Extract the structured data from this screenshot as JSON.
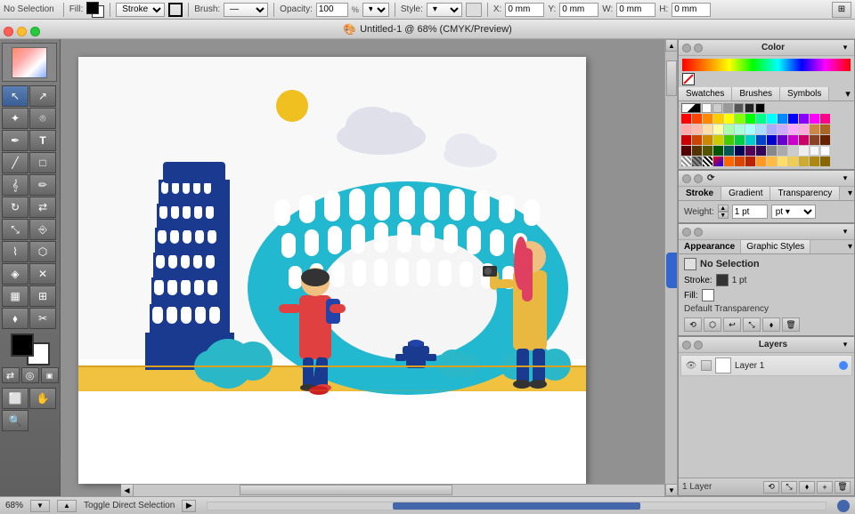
{
  "app": {
    "title": "Untitled-1 @ 68% (CMYK/Preview)",
    "title_icon": "🎨"
  },
  "toolbar": {
    "no_selection": "No Selection",
    "fill_label": "Fill:",
    "stroke_label": "Stroke",
    "brush_label": "Brush:",
    "opacity_label": "Opacity:",
    "opacity_value": "100",
    "style_label": "Style:",
    "x_label": "X:",
    "x_value": "0 mm",
    "y_label": "Y:",
    "y_value": "0 mm",
    "w_label": "W:",
    "w_value": "0 mm",
    "h_label": "H:",
    "h_value": "0 mm",
    "stroke_value": "1 pt"
  },
  "panels": {
    "color": {
      "title": "Color",
      "tabs": [
        "Swatches",
        "Brushes",
        "Symbols"
      ]
    },
    "stroke": {
      "title": "Stroke",
      "tabs": [
        "Stroke",
        "Gradient",
        "Transparency"
      ],
      "weight_label": "Weight:",
      "weight_value": "1 pt"
    },
    "appearance": {
      "title": "Appearance",
      "tabs": [
        "Appearance",
        "Graphic Styles"
      ],
      "no_selection": "No Selection",
      "stroke_label": "Stroke:",
      "stroke_value": "1 pt",
      "fill_label": "Fill:",
      "default_transparency": "Default Transparency"
    },
    "layers": {
      "title": "Layers",
      "layer_name": "Layer 1",
      "layer_count": "1 Layer"
    }
  },
  "status": {
    "zoom": "68%",
    "toggle_label": "Toggle Direct Selection",
    "arrow_label": "▶"
  },
  "tools": [
    {
      "name": "selection",
      "icon": "↖",
      "label": "Selection Tool"
    },
    {
      "name": "direct-selection",
      "icon": "↗",
      "label": "Direct Selection Tool"
    },
    {
      "name": "magic-wand",
      "icon": "✦",
      "label": "Magic Wand"
    },
    {
      "name": "lasso",
      "icon": "⬤",
      "label": "Lasso Tool"
    },
    {
      "name": "pen",
      "icon": "✒",
      "label": "Pen Tool"
    },
    {
      "name": "type",
      "icon": "T",
      "label": "Type Tool"
    },
    {
      "name": "line",
      "icon": "╱",
      "label": "Line Tool"
    },
    {
      "name": "rectangle",
      "icon": "□",
      "label": "Rectangle Tool"
    },
    {
      "name": "paintbrush",
      "icon": "🖌",
      "label": "Paintbrush"
    },
    {
      "name": "pencil",
      "icon": "✏",
      "label": "Pencil"
    },
    {
      "name": "rotate",
      "icon": "↻",
      "label": "Rotate"
    },
    {
      "name": "reflect",
      "icon": "⇄",
      "label": "Reflect"
    },
    {
      "name": "scale",
      "icon": "⤡",
      "label": "Scale"
    },
    {
      "name": "shear",
      "icon": "⎆",
      "label": "Shear"
    },
    {
      "name": "warp",
      "icon": "⌇",
      "label": "Warp"
    },
    {
      "name": "blend",
      "icon": "⬡",
      "label": "Blend"
    },
    {
      "name": "eyedropper",
      "icon": "💧",
      "label": "Eyedropper"
    },
    {
      "name": "measure",
      "icon": "✕",
      "label": "Measure"
    },
    {
      "name": "gradient",
      "icon": "▦",
      "label": "Gradient"
    },
    {
      "name": "mesh",
      "icon": "⊞",
      "label": "Mesh"
    },
    {
      "name": "live-paint",
      "icon": "⬧",
      "label": "Live Paint"
    },
    {
      "name": "scissors",
      "icon": "✂",
      "label": "Scissors"
    },
    {
      "name": "artboard",
      "icon": "⬜",
      "label": "Artboard"
    },
    {
      "name": "hand",
      "icon": "✋",
      "label": "Hand"
    },
    {
      "name": "zoom",
      "icon": "🔍",
      "label": "Zoom"
    }
  ],
  "swatches": {
    "row1": [
      "#ffffff",
      "#cccccc",
      "#999999",
      "#666666",
      "#333333",
      "#000000",
      "#ff0000",
      "#ff6600",
      "#ffff00",
      "#00ff00",
      "#00ffff",
      "#0000ff",
      "#ff00ff",
      "#8800ff"
    ],
    "row2": [
      "#ffcccc",
      "#ffcc99",
      "#ffffcc",
      "#ccffcc",
      "#ccffff",
      "#ccccff",
      "#ffccff",
      "#ddccff",
      "#ff8888",
      "#ffaa66",
      "#ffff88",
      "#88ff88",
      "#88ffff",
      "#8888ff"
    ],
    "row3": [
      "#cc0000",
      "#cc6600",
      "#cccc00",
      "#00cc00",
      "#00cccc",
      "#0000cc",
      "#cc00cc",
      "#6600cc",
      "#880000",
      "#884400",
      "#888800",
      "#008800",
      "#008888",
      "#000088"
    ],
    "row4": [
      "#440000",
      "#442200",
      "#444400",
      "#004400",
      "#004444",
      "#000044",
      "#440044",
      "#220044",
      "#ffdddd",
      "#ffeedd",
      "#ffffdd",
      "#ddffdd",
      "#ddffff",
      "#ddddff"
    ],
    "row5": [
      "#888888",
      "#777777",
      "#666666",
      "#555555",
      "#444444",
      "#333333",
      "#222222",
      "#111111",
      "#ff4444",
      "#ffaa44",
      "#ffff44",
      "#44ff44",
      "#44ffff",
      "#4444ff"
    ]
  }
}
